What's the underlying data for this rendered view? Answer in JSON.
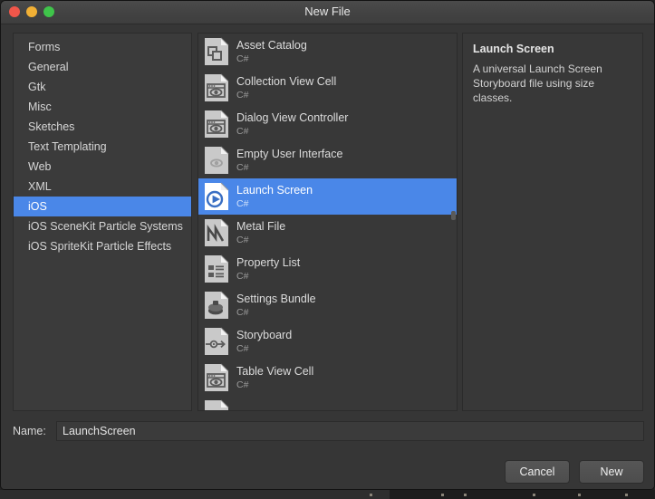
{
  "window": {
    "title": "New File",
    "traffic_lights": [
      {
        "name": "close-button",
        "color": "#f0564a"
      },
      {
        "name": "minimize-button",
        "color": "#f1b035"
      },
      {
        "name": "zoom-button",
        "color": "#3fc44a"
      }
    ]
  },
  "categories": {
    "selected_index": 8,
    "items": [
      {
        "label": "Forms"
      },
      {
        "label": "General"
      },
      {
        "label": "Gtk"
      },
      {
        "label": "Misc"
      },
      {
        "label": "Sketches"
      },
      {
        "label": "Text Templating"
      },
      {
        "label": "Web"
      },
      {
        "label": "XML"
      },
      {
        "label": "iOS"
      },
      {
        "label": "iOS SceneKit Particle Systems"
      },
      {
        "label": "iOS SpriteKit Particle Effects"
      }
    ]
  },
  "templates": {
    "selected_index": 4,
    "items": [
      {
        "title": "Asset Catalog",
        "subtitle": "C#",
        "icon": "asset-catalog-icon"
      },
      {
        "title": "Collection View Cell",
        "subtitle": "C#",
        "icon": "collection-view-cell-icon"
      },
      {
        "title": "Dialog View Controller",
        "subtitle": "C#",
        "icon": "dialog-view-controller-icon"
      },
      {
        "title": "Empty User Interface",
        "subtitle": "C#",
        "icon": "empty-user-interface-icon"
      },
      {
        "title": "Launch Screen",
        "subtitle": "C#",
        "icon": "launch-screen-icon"
      },
      {
        "title": "Metal File",
        "subtitle": "C#",
        "icon": "metal-file-icon"
      },
      {
        "title": "Property List",
        "subtitle": "C#",
        "icon": "property-list-icon"
      },
      {
        "title": "Settings Bundle",
        "subtitle": "C#",
        "icon": "settings-bundle-icon"
      },
      {
        "title": "Storyboard",
        "subtitle": "C#",
        "icon": "storyboard-icon"
      },
      {
        "title": "Table View Cell",
        "subtitle": "C#",
        "icon": "table-view-cell-icon"
      }
    ]
  },
  "details": {
    "title": "Launch Screen",
    "description": "A universal Launch Screen Storyboard file using size classes."
  },
  "name_field": {
    "label": "Name:",
    "value": "LaunchScreen",
    "placeholder": ""
  },
  "footer": {
    "cancel_label": "Cancel",
    "new_label": "New"
  },
  "colors": {
    "selection_blue": "#4a87e8",
    "window_bg": "#363636",
    "pane_bg": "#3b3b3b",
    "text": "#d6d6d6"
  }
}
